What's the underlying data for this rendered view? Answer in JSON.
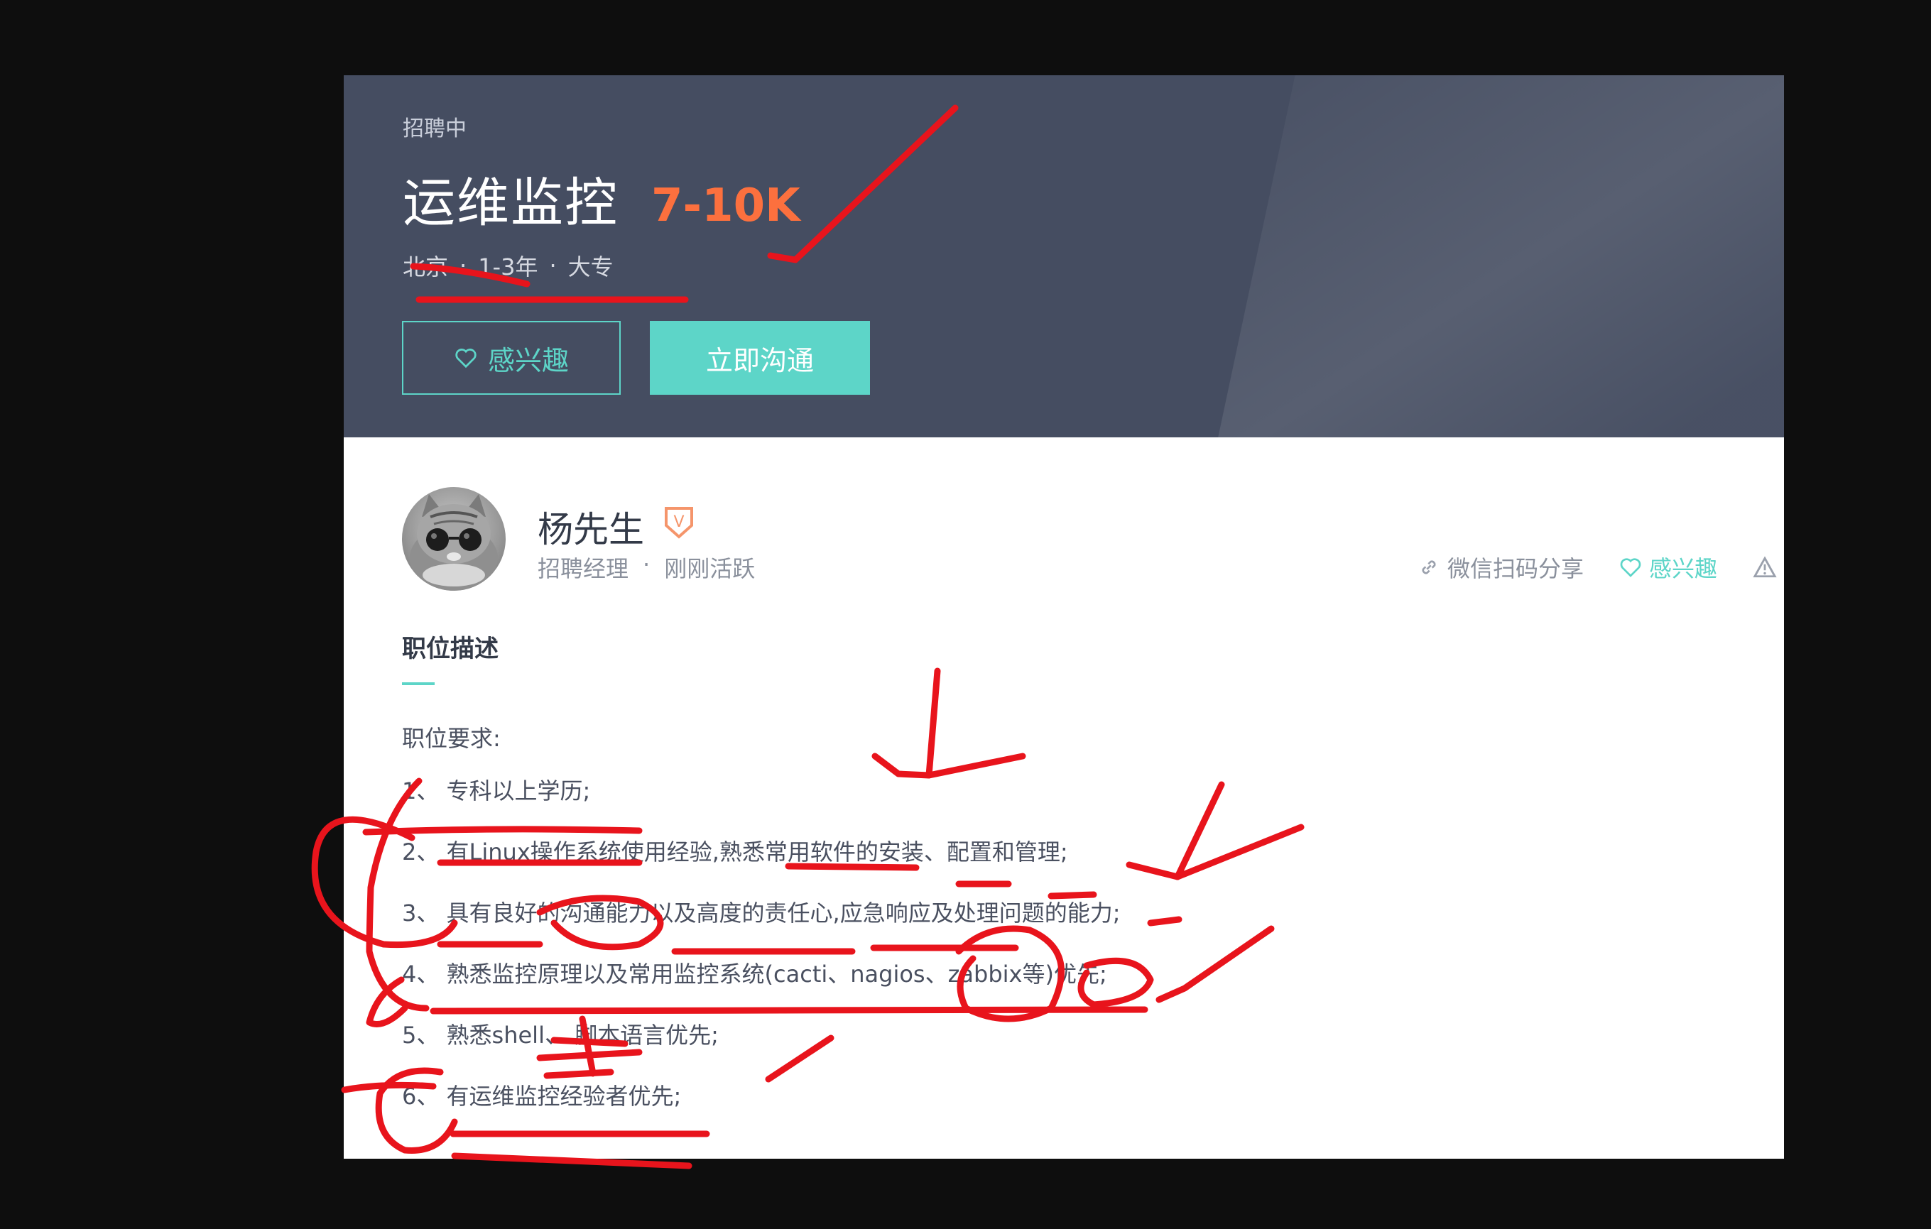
{
  "banner": {
    "status": "招聘中",
    "job_title": "运维监控",
    "salary": "7-10K",
    "city": "北京",
    "experience": "1-3年",
    "education": "大专",
    "separator": "·",
    "interest_label": "感兴趣",
    "chat_label": "立即沟通"
  },
  "recruiter": {
    "name": "杨先生",
    "role": "招聘经理",
    "activity": "刚刚活跃",
    "separator": "·",
    "verify_letter": "V",
    "share_label": "微信扫码分享",
    "interest_label": "感兴趣"
  },
  "description": {
    "section_title": "职位描述",
    "requirements_title": "职位要求:",
    "items": [
      "1、 专科以上学历;",
      "2、 有Linux操作系统使用经验,熟悉常用软件的安装、配置和管理;",
      "3、 具有良好的沟通能力以及高度的责任心,应急响应及处理问题的能力;",
      "4、 熟悉监控原理以及常用监控系统(cacti、nagios、zabbix等)优先;",
      "5、 熟悉shell、 脚本语言优先;",
      "6、 有运维监控经验者优先;"
    ]
  },
  "colors": {
    "banner_bg": "#454d61",
    "accent_teal": "#5dd5c8",
    "salary_orange": "#fc703e",
    "annotation_red": "#e8141c"
  },
  "icons": [
    "heart-icon",
    "verified-badge-icon",
    "link-icon",
    "warning-icon"
  ]
}
